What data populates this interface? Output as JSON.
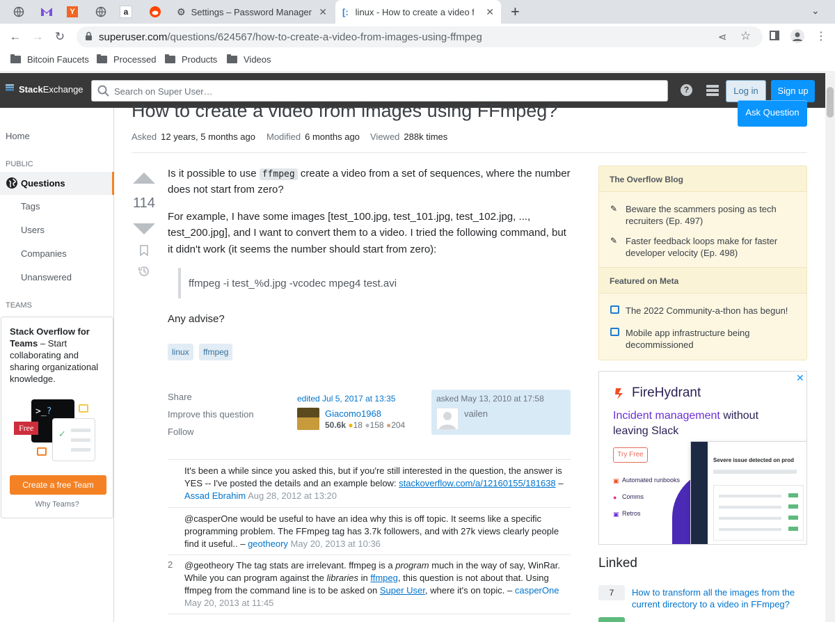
{
  "browser": {
    "tabs": [
      {
        "title": "Settings – Password Manager"
      },
      {
        "title": "linux - How to create a video fro"
      }
    ],
    "new_tab": "+",
    "url_domain": "superuser.com",
    "url_path": "/questions/624567/how-to-create-a-video-from-images-using-ffmpeg",
    "bookmarks": [
      "Bitcoin Faucets",
      "Processed",
      "Products",
      "Videos"
    ]
  },
  "header": {
    "logo_a": "Stack",
    "logo_b": "Exchange",
    "search_placeholder": "Search on Super User…",
    "login": "Log in",
    "signup": "Sign up"
  },
  "nav": {
    "home": "Home",
    "public": "PUBLIC",
    "questions": "Questions",
    "tags": "Tags",
    "users": "Users",
    "companies": "Companies",
    "unanswered": "Unanswered",
    "teams": "TEAMS",
    "teams_promo_bold": "Stack Overflow for Teams",
    "teams_promo_rest": " – Start collaborating and sharing organizational knowledge.",
    "free_badge": "Free",
    "create_team": "Create a free Team",
    "why_teams": "Why Teams?"
  },
  "question": {
    "title": "How to create a video from images using FFmpeg?",
    "ask_button": "Ask Question",
    "asked_label": "Asked",
    "asked_value": "12 years, 5 months ago",
    "modified_label": "Modified",
    "modified_value": "6 months ago",
    "viewed_label": "Viewed",
    "viewed_value": "288k times",
    "score": "114",
    "p1_a": "Is it possible to use ",
    "p1_code": "ffmpeg",
    "p1_b": " create a video from a set of sequences, where the number does not start from zero?",
    "p2": "For example, I have some images [test_100.jpg, test_101.jpg, test_102.jpg, ..., test_200.jpg], and I want to convert them to a video. I tried the following command, but it didn't work (it seems the number should start from zero):",
    "quote": "ffmpeg -i test_%d.jpg -vcodec mpeg4 test.avi",
    "p3": "Any advise?",
    "tags": [
      "linux",
      "ffmpeg"
    ],
    "share": "Share",
    "improve": "Improve this question",
    "follow": "Follow",
    "edited": "edited Jul 5, 2017 at 13:35",
    "editor_name": "Giacomo1968",
    "editor_rep": "50.6k",
    "editor_gold": "18",
    "editor_silver": "158",
    "editor_bronze": "204",
    "asked_on": "asked May 13, 2010 at 17:58",
    "asker_name": "vailen"
  },
  "comments": [
    {
      "score": "",
      "text": "It's been a while since you asked this, but if you're still interested in the question, the answer is YES -- I've posted the details and an example below: ",
      "link": "stackoverflow.com/a/12160155/181638",
      "user": "Assad Ebrahim",
      "date": "Aug 28, 2012 at 13:20"
    },
    {
      "score": "",
      "text": "@casperOne would be useful to have an idea why this is off topic. It seems like a specific programming problem. The FFmpeg tag has 3.7k followers, and with 27k views clearly people find it useful..",
      "user": "geotheory",
      "date": "May 20, 2013 at 10:36"
    },
    {
      "score": "2",
      "text_a": "@geotheory The tag stats are irrelevant. ffmpeg is a ",
      "text_em1": "program",
      "text_b": " much in the way of say, WinRar. While you can program against the ",
      "text_em2": "libraries",
      "text_c": " in ",
      "link1": "ffmpeg",
      "text_d": ", this question is not about that. Using ffmpeg from the command line is to be asked on ",
      "link2": "Super User",
      "text_e": ", where it's on topic.",
      "user": "casperOne",
      "date": "May 20, 2013 at 11:45"
    }
  ],
  "sidebar": {
    "blog_title": "The Overflow Blog",
    "blog_items": [
      "Beware the scammers posing as tech recruiters (Ep. 497)",
      "Faster feedback loops make for faster developer velocity (Ep. 498)"
    ],
    "meta_title": "Featured on Meta",
    "meta_items": [
      "The 2022 Community-a-thon has begun!",
      "Mobile app infrastructure being decommissioned"
    ],
    "ad_brand": "FireHydrant",
    "ad_headline_a": "Incident management",
    "ad_headline_b": " without leaving Slack",
    "ad_cta": "Try Free",
    "ad_features": [
      "Automated runbooks",
      "Comms",
      "Retros"
    ],
    "ad_screen_title": "Severe issue detected on prod",
    "linked_title": "Linked",
    "linked_count": "7",
    "linked_q": "How to transform all the images from the current directory to a video in FFmpeg?"
  },
  "colors": {
    "accent": "#0a95ff",
    "orange": "#f48225",
    "link": "#0074cc"
  }
}
